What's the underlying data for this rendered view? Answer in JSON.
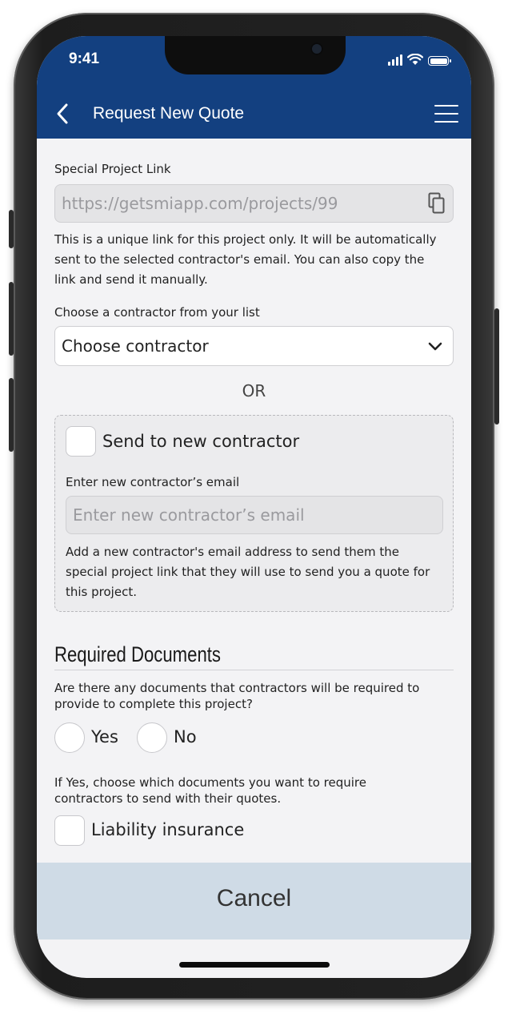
{
  "status_bar": {
    "time": "9:41"
  },
  "header": {
    "title": "Request New Quote"
  },
  "project_link": {
    "label": "Special Project Link",
    "value": "https://getsmiapp.com/projects/99",
    "help_line1": "This is a unique link for this project only. It will be automatically",
    "help_line2": "sent to the selected contractor's email. You can also copy the",
    "help_line3": "link and send it manually."
  },
  "contractor_select": {
    "label": "Choose a contractor from your list",
    "selected": "Choose contractor"
  },
  "or_text": "OR",
  "new_contractor": {
    "checkbox_label": "Send to new contractor",
    "email_label": "Enter new contractor’s email",
    "email_placeholder": "Enter new contractor’s email",
    "help_line1": "Add a new contractor's email address to send them the",
    "help_line2": "special project link that they will use to send you a quote for",
    "help_line3": "this project."
  },
  "required_documents": {
    "title": "Required Documents",
    "question_line1": "Are there any documents that contractors will be required to",
    "question_line2": "provide to complete this project?",
    "options": [
      "Yes",
      "No"
    ],
    "instruction_line1": "If Yes, choose which documents you want to require",
    "instruction_line2": "contractors to send with their quotes.",
    "documents": [
      "Liability insurance"
    ]
  },
  "footer": {
    "cancel_label": "Cancel"
  },
  "colors": {
    "header_bg": "#134080",
    "cancel_bg": "#cfdbe6",
    "screen_bg": "#f3f3f5"
  }
}
